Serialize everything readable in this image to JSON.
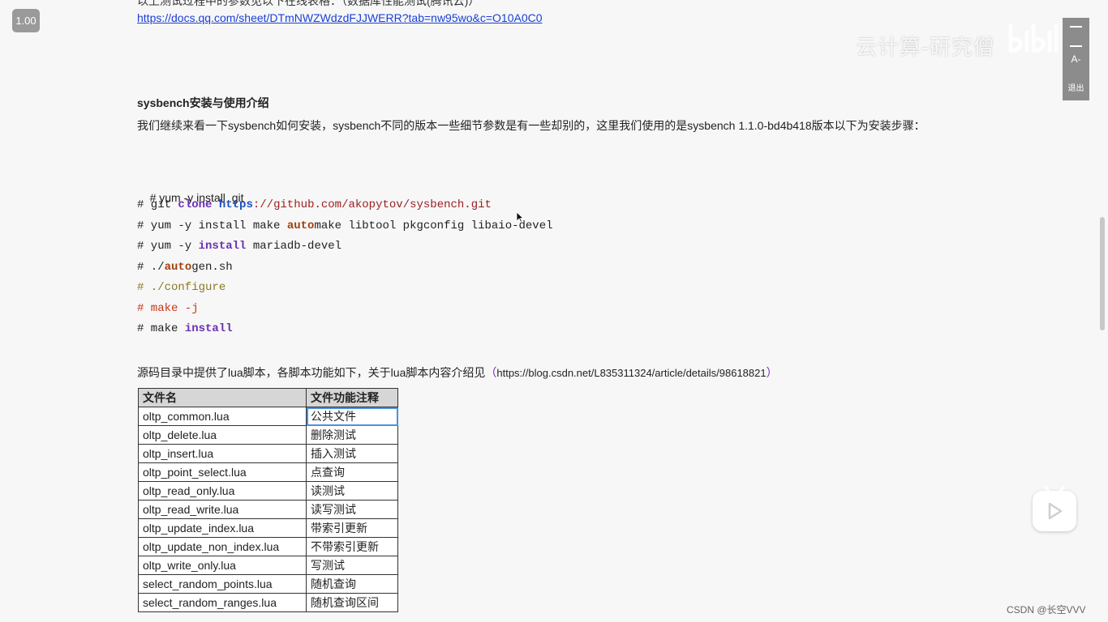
{
  "doc": {
    "clipped_line": "以上测试过程中的参数见以下在线表格：（数据库性能测试(腾讯云)）",
    "link": "https://docs.qq.com/sheet/DTmNWZWdzdFJJWERR?tab=nw95wo&c=O10A0C0",
    "heading": "sysbench安装与使用介绍",
    "paragraph": "我们继续来看一下sysbench如何安装，sysbench不同的版本一些细节参数是有一些却别的，这里我们使用的是sysbench 1.1.0-bd4b418版本以下为安装步骤：",
    "code_lines": {
      "l1": "# yum -y install  git",
      "l2_prefix": "# git ",
      "l2_clone": "clone",
      "l2_https": "https",
      "l2_rest": "://github.com/akopytov/sysbench.git",
      "l3_prefix": "# yum -y install make ",
      "l3_auto": "auto",
      "l3_rest": "make libtool pkgconfig libaio-devel",
      "l4_prefix": "# yum -y ",
      "l4_install": "install",
      "l4_rest": " mariadb-devel",
      "l5_prefix": "# ./",
      "l5_auto": "auto",
      "l5_rest": "gen.sh",
      "l6": "# ./configure",
      "l7": "# make -j",
      "l8_prefix": "# make ",
      "l8_install": "install"
    },
    "lua_intro": "源码目录中提供了lua脚本，各脚本功能如下，关于lua脚本内容介绍见",
    "lua_paren_open": "（",
    "lua_url": "https://blog.csdn.net/L835311324/article/details/98618821",
    "lua_paren_close": "）",
    "table": {
      "headers": [
        "文件名",
        "文件功能注释"
      ],
      "rows": [
        [
          "oltp_common.lua",
          "公共文件"
        ],
        [
          "oltp_delete.lua",
          "删除测试"
        ],
        [
          "oltp_insert.lua",
          "插入测试"
        ],
        [
          "oltp_point_select.lua",
          "点查询"
        ],
        [
          "oltp_read_only.lua",
          "读测试"
        ],
        [
          "oltp_read_write.lua",
          "读写测试"
        ],
        [
          "oltp_update_index.lua",
          "带索引更新"
        ],
        [
          "oltp_update_non_index.lua",
          "不带索引更新"
        ],
        [
          "oltp_write_only.lua",
          "写测试"
        ],
        [
          "select_random_points.lua",
          "随机查询"
        ],
        [
          "select_random_ranges.lua",
          "随机查询区间"
        ]
      ]
    }
  },
  "player": {
    "speed": "1.00",
    "watermark": "云计算-研究僧",
    "side_panel": {
      "font_label": "A-",
      "exit_label": "退出"
    }
  },
  "credit": "CSDN @长空VVV",
  "colors": {
    "link": "#1a3fd6",
    "keyword_purple": "#6b2fb3",
    "keyword_blue": "#1c4fbf",
    "keyword_brown": "#a04010",
    "string_red": "#9a1d1d",
    "comment_olive": "#8a7b22",
    "comment_red": "#c7361a"
  }
}
